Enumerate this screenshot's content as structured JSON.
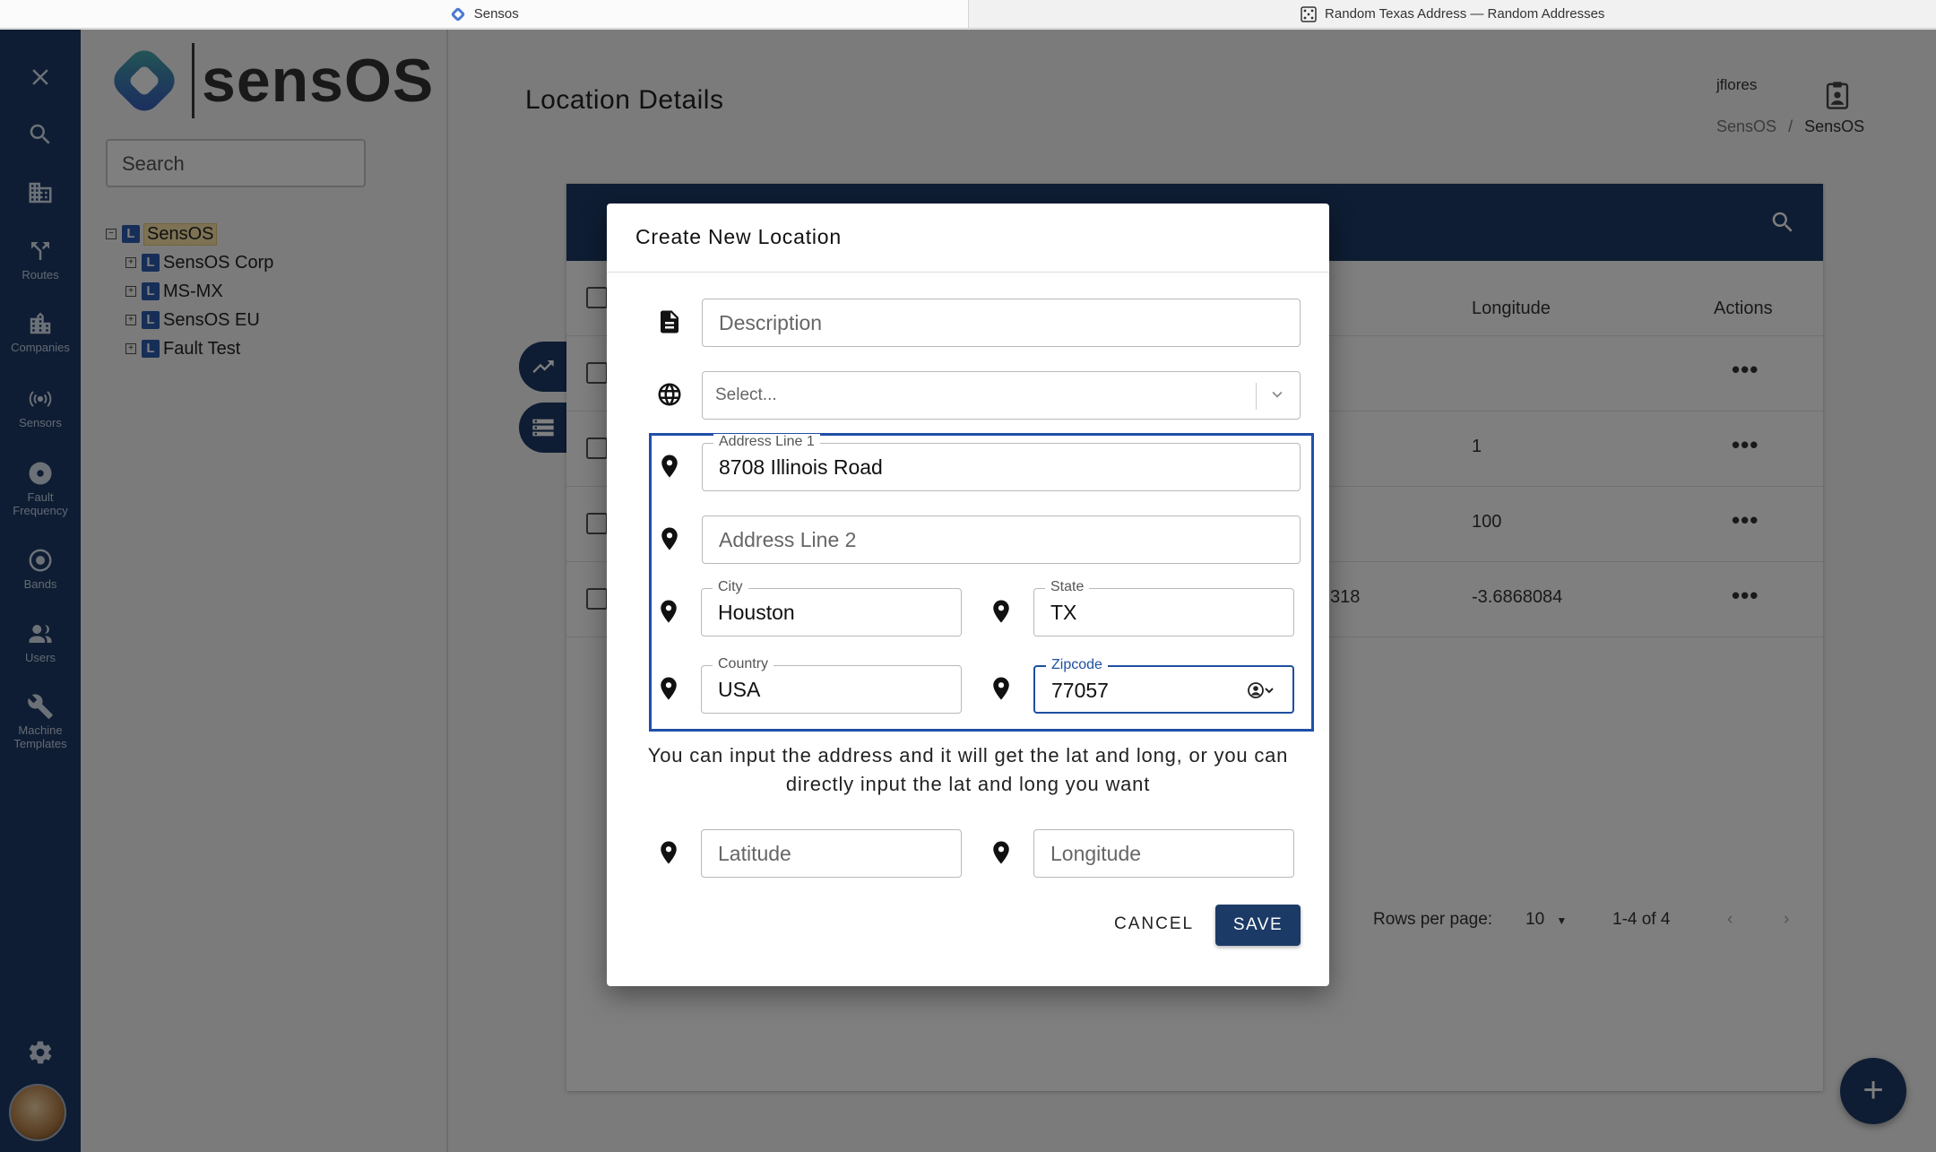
{
  "browser": {
    "tabs": [
      {
        "title": "Sensos"
      },
      {
        "title": "Random Texas Address — Random Addresses"
      }
    ]
  },
  "rail": {
    "items": [
      {
        "label": ""
      },
      {
        "label": ""
      },
      {
        "label": ""
      },
      {
        "label": "Routes"
      },
      {
        "label": "Companies"
      },
      {
        "label": "Sensors"
      },
      {
        "label": "Fault Frequency"
      },
      {
        "label": "Bands"
      },
      {
        "label": "Users"
      },
      {
        "label": "Machine Templates"
      }
    ]
  },
  "brand": {
    "name": "sensOS"
  },
  "tree_panel": {
    "search_placeholder": "Search",
    "nodes": [
      {
        "label": "SensOS"
      },
      {
        "label": "SensOS Corp"
      },
      {
        "label": "MS-MX"
      },
      {
        "label": "SensOS EU"
      },
      {
        "label": "Fault Test"
      }
    ]
  },
  "main": {
    "title": "Location Details",
    "user": "jflores",
    "breadcrumb": {
      "first": "SensOS",
      "separator": "/",
      "current": "SensOS"
    },
    "table": {
      "columns": {
        "longitude": "Longitude",
        "actions": "Actions"
      },
      "rows": [
        {
          "partial": "",
          "longitude": "",
          "actions": "•••"
        },
        {
          "partial": "",
          "longitude": "1",
          "actions": "•••"
        },
        {
          "partial": "",
          "longitude": "100",
          "actions": "•••"
        },
        {
          "partial": "318",
          "longitude": "-3.6868084",
          "actions": "•••"
        }
      ],
      "pager": {
        "rows_per_page_label": "Rows per page:",
        "rows_per_page": "10",
        "range": "1-4 of 4"
      }
    },
    "fab": "+"
  },
  "dialog": {
    "title": "Create New Location",
    "description_placeholder": "Description",
    "timezone_placeholder": "Select...",
    "address1": {
      "label": "Address Line 1",
      "value": "8708 Illinois Road"
    },
    "address2_placeholder": "Address Line 2",
    "city": {
      "label": "City",
      "value": "Houston"
    },
    "state": {
      "label": "State",
      "value": "TX"
    },
    "country": {
      "label": "Country",
      "value": "USA"
    },
    "zipcode": {
      "label": "Zipcode",
      "value": "77057"
    },
    "helper_text": "You can input the address and it will get the lat and long, or you can directly input the lat and long you want",
    "latitude_placeholder": "Latitude",
    "longitude_placeholder": "Longitude",
    "cancel_label": "CANCEL",
    "save_label": "SAVE"
  },
  "colors": {
    "navy": "#1c3a66",
    "focus_blue": "#1f4fa8"
  }
}
